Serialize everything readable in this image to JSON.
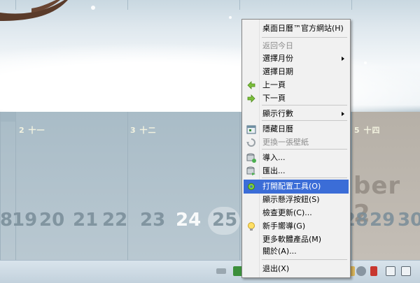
{
  "calendar": {
    "day_headers": [
      "2 十一",
      "3 十二",
      "5 十四"
    ],
    "dates": [
      "8",
      "19",
      "20",
      "21",
      "22",
      "23",
      "24",
      "25",
      "28",
      "29",
      "30"
    ],
    "month_word": "ber 2"
  },
  "menu": {
    "items": [
      {
        "label": "桌面日曆™官方網站(H)",
        "disabled": false
      },
      {
        "label": "返回今日",
        "disabled": true
      },
      {
        "label": "選擇月份",
        "disabled": false,
        "submenu": true
      },
      {
        "label": "選擇日期",
        "disabled": false
      },
      {
        "label": "上一頁",
        "disabled": false,
        "icon": "arrow-left-icon"
      },
      {
        "label": "下一頁",
        "disabled": false,
        "icon": "arrow-right-icon"
      },
      {
        "label": "顯示行數",
        "disabled": false,
        "submenu": true
      },
      {
        "label": "隱藏日曆",
        "disabled": false,
        "icon": "calendar-icon"
      },
      {
        "label": "更換一張壁紙",
        "disabled": true,
        "icon": "refresh-icon"
      },
      {
        "label": "導入...",
        "disabled": false,
        "icon": "database-import-icon"
      },
      {
        "label": "匯出...",
        "disabled": false,
        "icon": "database-export-icon"
      },
      {
        "label": "打開配置工具(O)",
        "disabled": false,
        "selected": true,
        "icon": "gear-icon"
      },
      {
        "label": "顯示懸浮按鈕(S)",
        "disabled": false
      },
      {
        "label": "檢查更新(C)...",
        "disabled": false
      },
      {
        "label": "新手嚮導(G)",
        "disabled": false,
        "icon": "lightbulb-icon"
      },
      {
        "label": "更多軟體產品(M)",
        "disabled": false
      },
      {
        "label": "關於(A)...",
        "disabled": false
      },
      {
        "label": "退出(X)",
        "disabled": false
      }
    ]
  },
  "colors": {
    "menu_highlight": "#3b6dd7",
    "menu_background": "#f1f1f1",
    "disabled_text": "#8d8d8d"
  }
}
